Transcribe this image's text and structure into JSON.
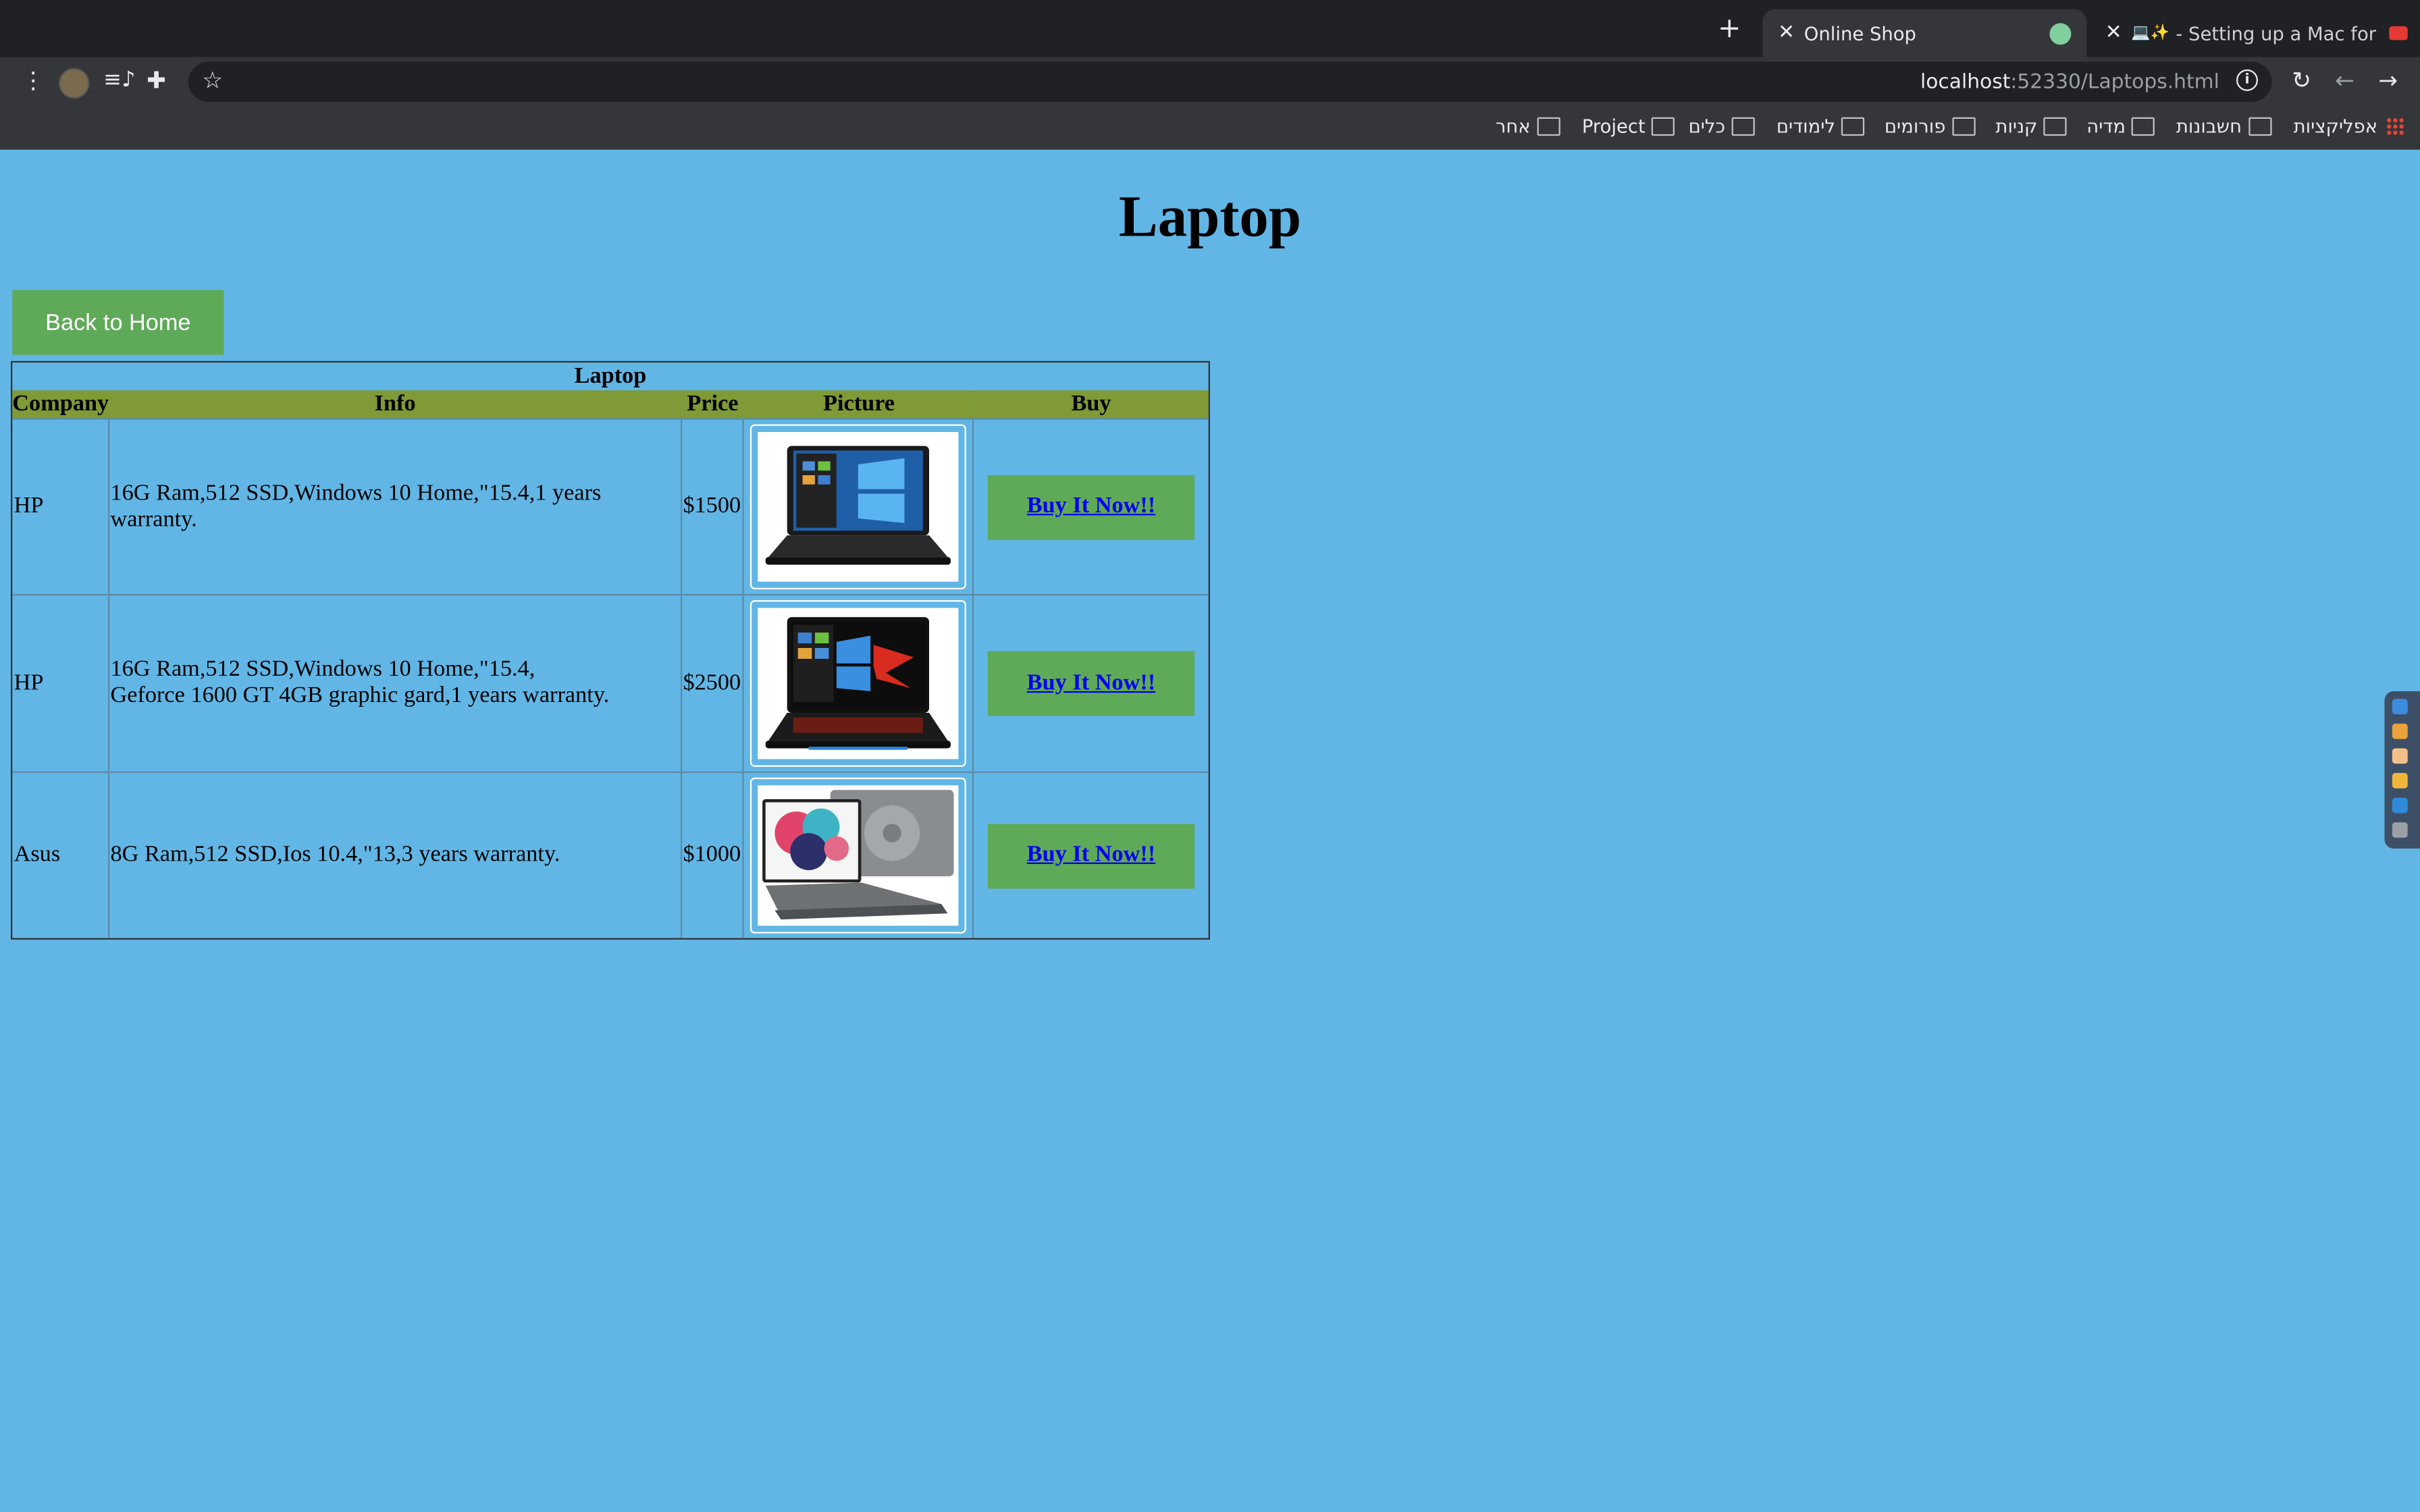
{
  "browser": {
    "tabs": [
      {
        "title": "Online Shop",
        "active": true
      },
      {
        "title": "- Setting up a Mac for W",
        "prefix": "💻✨",
        "active": false
      }
    ],
    "url_host": "localhost",
    "url_path": ":52330/Laptops.html",
    "bookmarks": [
      "אפליקציות",
      "חשבונות",
      "מדיה",
      "קניות",
      "פורומים",
      "לימודים",
      "כלים",
      "Project",
      "אחר"
    ]
  },
  "page": {
    "heading": "Laptop",
    "home_button": "Back to Home",
    "table": {
      "caption": "Laptop",
      "headers": [
        "Company",
        "Info",
        "Price",
        "Picture",
        "Buy"
      ],
      "rows": [
        {
          "company": "HP",
          "info_line1": "16G Ram,512 SSD,Windows 10 Home,\"15.4,1 years warranty.",
          "info_line2": "",
          "price": "$1500",
          "buy": "Buy It Now!!"
        },
        {
          "company": "HP",
          "info_line1": "16G Ram,512 SSD,Windows 10 Home,\"15.4,",
          "info_line2": "Geforce 1600 GT 4GB graphic gard,1 years warranty.",
          "price": "$2500",
          "buy": "Buy It Now!!"
        },
        {
          "company": "Asus",
          "info_line1": "8G Ram,512 SSD,Ios 10.4,\"13,3 years warranty.",
          "info_line2": "",
          "price": "$1000",
          "buy": "Buy It Now!!"
        }
      ]
    }
  },
  "colors": {
    "page_background": "#62b6e5",
    "button_green": "#5faa58",
    "header_olive": "#7f9a36",
    "link_blue": "#0000ee"
  }
}
